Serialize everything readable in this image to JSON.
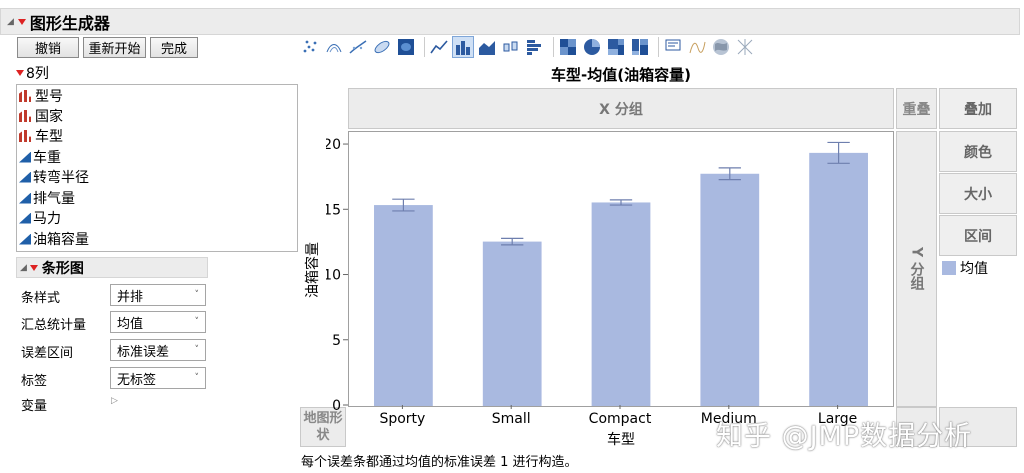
{
  "window": {
    "title": "图形生成器"
  },
  "buttons": {
    "undo": "撤销",
    "restart": "重新开始",
    "done": "完成"
  },
  "columns": {
    "header": "8列",
    "items": [
      {
        "label": "型号",
        "kind": "nominal"
      },
      {
        "label": "国家",
        "kind": "nominal"
      },
      {
        "label": "车型",
        "kind": "nominal"
      },
      {
        "label": "车重",
        "kind": "continuous"
      },
      {
        "label": "转弯半径",
        "kind": "continuous"
      },
      {
        "label": "排气量",
        "kind": "continuous"
      },
      {
        "label": "马力",
        "kind": "continuous"
      },
      {
        "label": "油箱容量",
        "kind": "continuous"
      }
    ]
  },
  "bar_panel": {
    "title": "条形图",
    "options": [
      {
        "label": "条样式",
        "value": "并排"
      },
      {
        "label": "汇总统计量",
        "value": "均值"
      },
      {
        "label": "误差区间",
        "value": "标准误差"
      },
      {
        "label": "标签",
        "value": "无标签"
      }
    ],
    "variables_label": "变量"
  },
  "toolbar": {
    "icons": [
      "points-icon",
      "contour-icon",
      "smoother-icon",
      "ellipse-icon",
      "density-icon",
      "line-icon",
      "bar-icon",
      "area-icon",
      "box-plot-icon",
      "histogram-icon",
      "heatmap-icon",
      "pie-icon",
      "treemap-icon",
      "mosaic-icon",
      "caption-icon",
      "formula-icon",
      "map-shape-icon",
      "parallel-icon"
    ]
  },
  "graph": {
    "title": "车型-均值(油箱容量)",
    "x_group": "X 分组",
    "y_group": "Y 分组",
    "overlay": "重叠",
    "map_shape": "地图形状",
    "side_buttons": {
      "overlay": "叠加",
      "color": "颜色",
      "size": "大小",
      "interval": "区间"
    },
    "legend_label": "均值",
    "footnote": "每个误差条都通过均值的标准误差 1 进行构造。",
    "bar_color": "#a9b9e0",
    "err_color": "#6e7fae"
  },
  "chart_data": {
    "type": "bar",
    "categories": [
      "Sporty",
      "Small",
      "Compact",
      "Medium",
      "Large"
    ],
    "values": [
      15.4,
      12.6,
      15.6,
      17.8,
      19.4
    ],
    "error": [
      0.45,
      0.25,
      0.2,
      0.45,
      0.8
    ],
    "xlabel": "车型",
    "ylabel": "油箱容量",
    "ylim": [
      0,
      21
    ],
    "yticks": [
      0,
      5,
      10,
      15,
      20
    ],
    "series": [
      {
        "name": "均值",
        "values": [
          15.4,
          12.6,
          15.6,
          17.8,
          19.4
        ]
      }
    ]
  },
  "watermark": "知乎 @JMP数据分析"
}
